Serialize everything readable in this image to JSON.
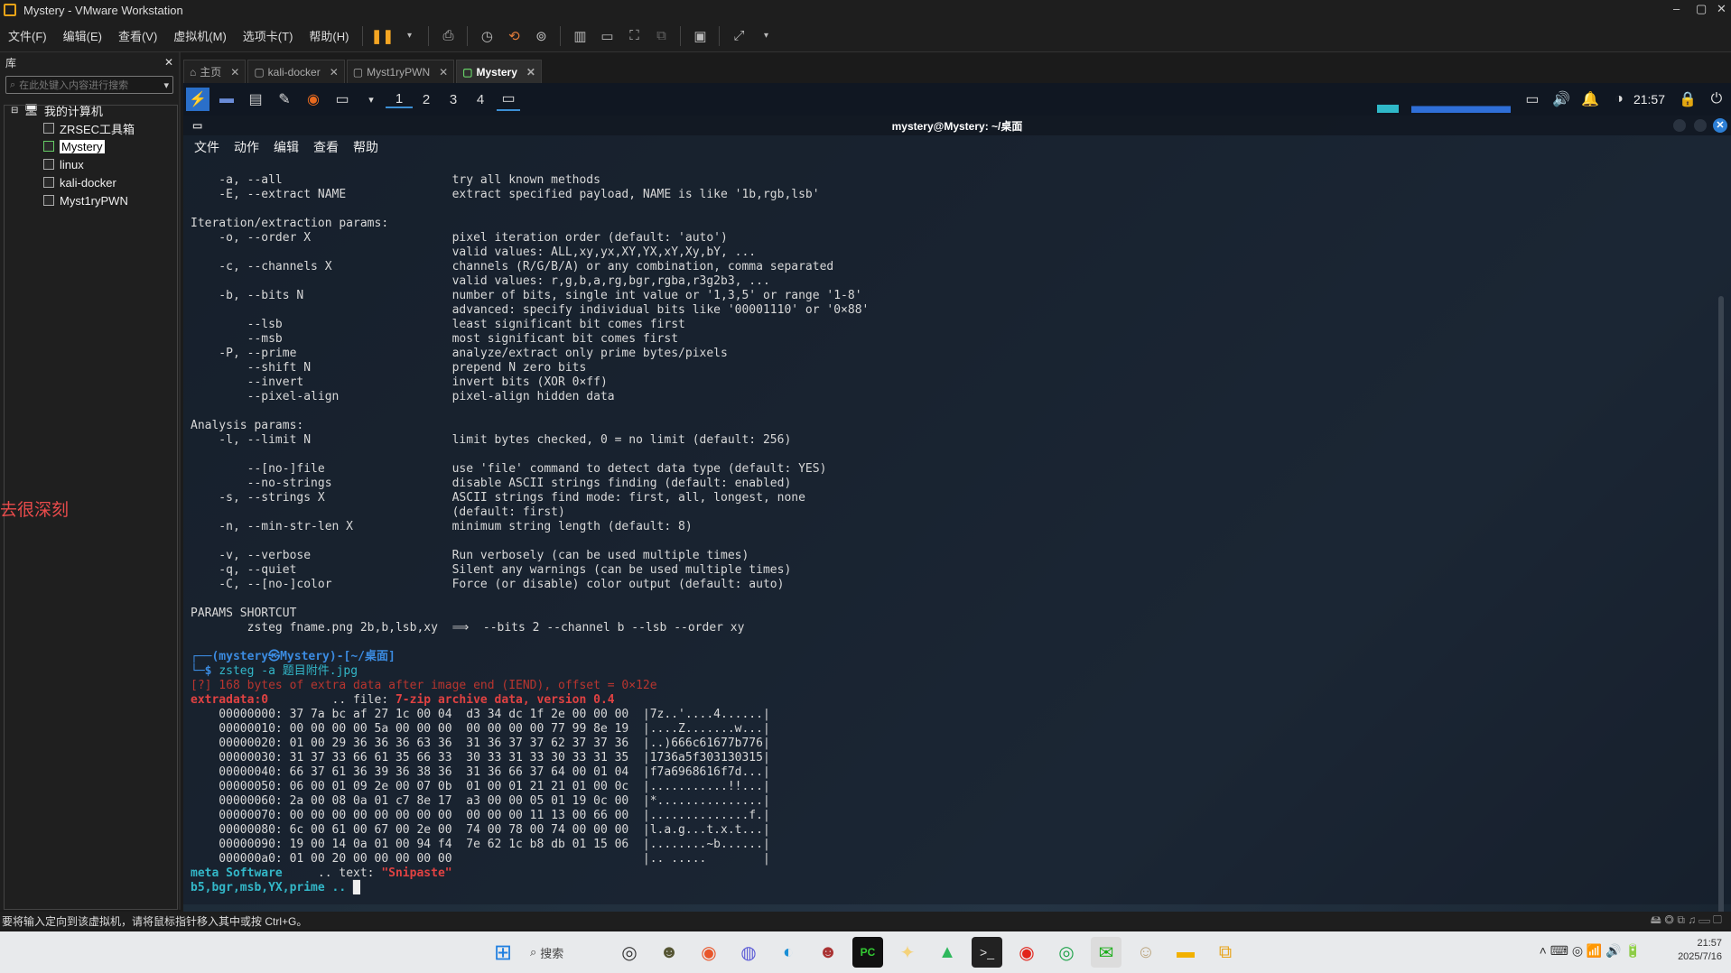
{
  "window": {
    "title": "Mystery - VMware Workstation",
    "min": "–",
    "max": "▢",
    "close": "✕"
  },
  "menu": [
    "文件(F)",
    "编辑(E)",
    "查看(V)",
    "虚拟机(M)",
    "选项卡(T)",
    "帮助(H)"
  ],
  "library": {
    "title": "库",
    "close": "✕",
    "search_placeholder": "在此处键入内容进行搜索",
    "root": "我的计算机",
    "items": [
      "ZRSEC工具箱",
      "Mystery",
      "linux",
      "kali-docker",
      "Myst1ryPWN"
    ],
    "selected": "Mystery"
  },
  "side_text": "去很深刻",
  "tabs": [
    {
      "label": "主页",
      "close": "✕"
    },
    {
      "label": "kali-docker",
      "close": "✕"
    },
    {
      "label": "Myst1ryPWN",
      "close": "✕"
    },
    {
      "label": "Mystery",
      "close": "✕"
    }
  ],
  "panel": {
    "workspaces": [
      "1",
      "2",
      "3",
      "4"
    ],
    "clock": "21:57"
  },
  "terminal": {
    "title": "mystery@Mystery: ~/桌面",
    "menu": [
      "文件",
      "动作",
      "编辑",
      "查看",
      "帮助"
    ],
    "help_lines": [
      "    -a, --all                        try all known methods",
      "    -E, --extract NAME               extract specified payload, NAME is like '1b,rgb,lsb'",
      "",
      "Iteration/extraction params:",
      "    -o, --order X                    pixel iteration order (default: 'auto')",
      "                                     valid values: ALL,xy,yx,XY,YX,xY,Xy,bY, ...",
      "    -c, --channels X                 channels (R/G/B/A) or any combination, comma separated",
      "                                     valid values: r,g,b,a,rg,bgr,rgba,r3g2b3, ...",
      "    -b, --bits N                     number of bits, single int value or '1,3,5' or range '1-8'",
      "                                     advanced: specify individual bits like '00001110' or '0×88'",
      "        --lsb                        least significant bit comes first",
      "        --msb                        most significant bit comes first",
      "    -P, --prime                      analyze/extract only prime bytes/pixels",
      "        --shift N                    prepend N zero bits",
      "        --invert                     invert bits (XOR 0×ff)",
      "        --pixel-align                pixel-align hidden data",
      "",
      "Analysis params:",
      "    -l, --limit N                    limit bytes checked, 0 = no limit (default: 256)",
      "",
      "        --[no-]file                  use 'file' command to detect data type (default: YES)",
      "        --no-strings                 disable ASCII strings finding (default: enabled)",
      "    -s, --strings X                  ASCII strings find mode: first, all, longest, none",
      "                                     (default: first)",
      "    -n, --min-str-len X              minimum string length (default: 8)",
      "",
      "    -v, --verbose                    Run verbosely (can be used multiple times)",
      "    -q, --quiet                      Silent any warnings (can be used multiple times)",
      "    -C, --[no-]color                 Force (or disable) color output (default: auto)",
      "",
      "PARAMS SHORTCUT",
      "        zsteg fname.png 2b,b,lsb,xy  ⟹  --bits 2 --channel b --lsb --order xy",
      ""
    ],
    "prompt_user": "┌──(mystery㉿Mystery)-[~/桌面]",
    "prompt_cmd_prefix": "└─$ ",
    "command": "zsteg -a 题目附件.jpg",
    "warning": "[?] 168 bytes of extra data after image end (IEND), offset = 0×12e",
    "extra_label": "extradata:0",
    "extra_mid": "         .. file: ",
    "extra_file": "7-zip archive data, version 0.4",
    "hex_lines": [
      "    00000000: 37 7a bc af 27 1c 00 04  d3 34 dc 1f 2e 00 00 00  |7z..'....4......|",
      "    00000010: 00 00 00 00 5a 00 00 00  00 00 00 00 77 99 8e 19  |....Z.......w...|",
      "    00000020: 01 00 29 36 36 36 63 36  31 36 37 37 62 37 37 36  |..)666c61677b776|",
      "    00000030: 31 37 33 66 61 35 66 33  30 33 31 33 30 33 31 35  |1736a5f303130315|",
      "    00000040: 66 37 61 36 39 36 38 36  31 36 66 37 64 00 01 04  |f7a6968616f7d...|",
      "    00000050: 06 00 01 09 2e 00 07 0b  01 00 01 21 21 01 00 0c  |...........!!...|",
      "    00000060: 2a 00 08 0a 01 c7 8e 17  a3 00 00 05 01 19 0c 00  |*...............|",
      "    00000070: 00 00 00 00 00 00 00 00  00 00 00 11 13 00 66 00  |..............f.|",
      "    00000080: 6c 00 61 00 67 00 2e 00  74 00 78 00 74 00 00 00  |l.a.g...t.x.t...|",
      "    00000090: 19 00 14 0a 01 00 94 f4  7e 62 1c b8 db 01 15 06  |........~b......|",
      "    000000a0: 01 00 20 00 00 00 00 00                           |.. .....        |"
    ],
    "meta_label": "meta Software",
    "meta_mid": "     .. text: ",
    "meta_text": "\"Snipaste\"",
    "last_line": "b5,bgr,msb,YX,prime .. "
  },
  "status": "要将输入定向到该虚拟机，请将鼠标指针移入其中或按 Ctrl+G。",
  "taskbar": {
    "search": "搜索",
    "time": "21:57",
    "date": "2025/7/16"
  },
  "colors": {
    "accent": "#3c8fd4",
    "prompt": "#3b8be0",
    "error": "#e04242"
  }
}
